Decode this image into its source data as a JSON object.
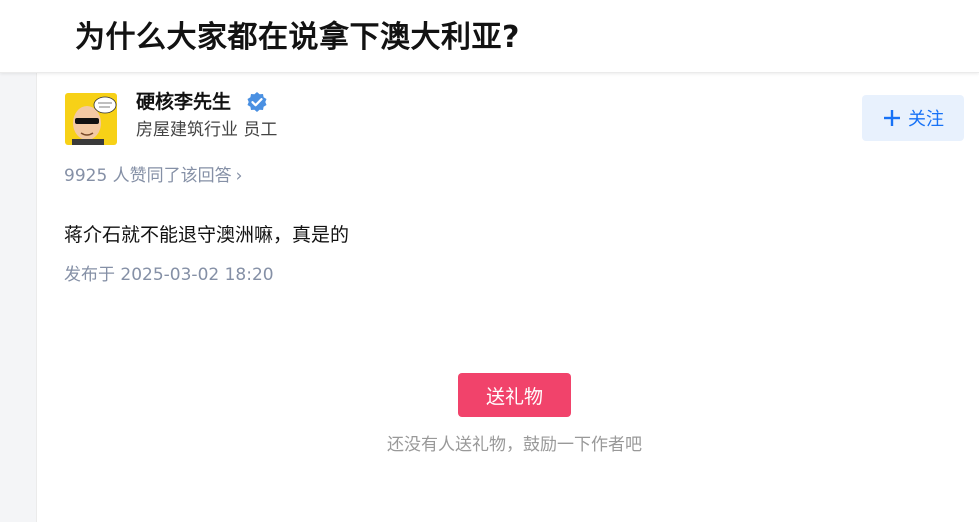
{
  "question": {
    "title": "为什么大家都在说拿下澳大利亚?"
  },
  "author": {
    "name": "硬核李先生",
    "headline": "房屋建筑行业 员工",
    "verified": true,
    "avatar": "cartoon-bald-man-sunglasses",
    "verified_color": "#1772f6"
  },
  "follow": {
    "label": "关注",
    "icon": "plus-icon"
  },
  "votes": {
    "text": "9925 人赞同了该回答",
    "chevron": "›"
  },
  "answer": {
    "content": "蒋介石就不能退守澳洲嘛，真是的",
    "published": "发布于 2025-03-02 18:20"
  },
  "gift": {
    "button_label": "送礼物",
    "hint": "还没有人送礼物，鼓励一下作者吧"
  },
  "colors": {
    "accent": "#1772f6",
    "gift": "#f1436b",
    "meta_text": "#8590a6"
  }
}
